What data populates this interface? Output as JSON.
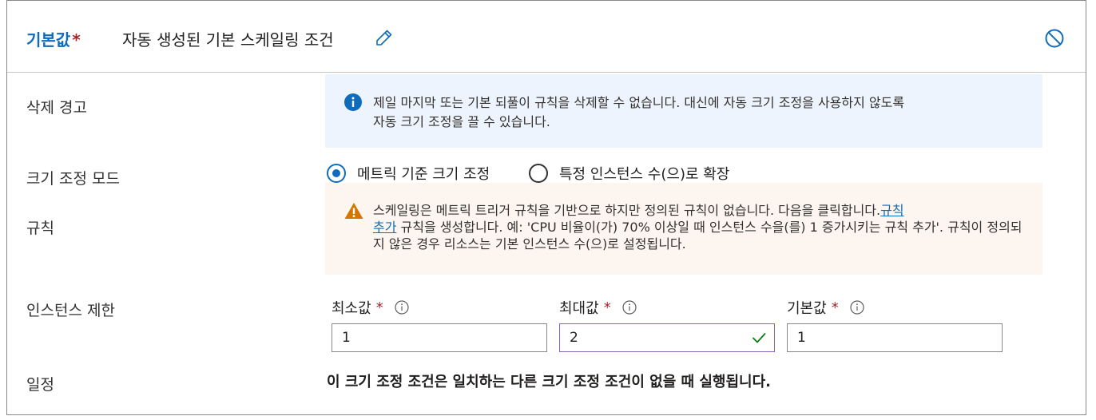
{
  "header": {
    "label": "기본값",
    "required_mark": "*",
    "title": "자동 생성된 기본 스케일링 조건",
    "edit_icon": "pencil-icon",
    "disable_icon": "circle-slash-icon"
  },
  "rows": {
    "delete_warning": "삭제 경고",
    "scale_mode": "크기 조정 모드",
    "rules": "규칙",
    "instance_limits": "인스턴스 제한",
    "schedule": "일정"
  },
  "info_message": {
    "icon": "info-icon",
    "line1": "제일 마지막 또는 기본 되풀이 규칙을 삭제할 수 없습니다. 대신에 자동 크기 조정을 사용하지 않도록",
    "line2": "자동 크기 조정을 끌 수 있습니다."
  },
  "scale_mode": {
    "options": [
      {
        "label": "메트릭 기준 크기 조정",
        "selected": true
      },
      {
        "label": "특정 인스턴스 수(으)로 확장",
        "selected": false
      }
    ]
  },
  "warning_message": {
    "icon": "warning-icon",
    "text_start": "스케일링은 메트릭 트리거 규칙을 기반으로 하지만 정의된 규칙이 없습니다. 다음을 클릭합니다.",
    "link_part1": "규칙",
    "link_part2": "추가",
    "text_end": " 규칙을 생성합니다. 예: 'CPU 비율이(가) 70% 이상일 때 인스턴스 수을(를) 1 증가시키는 규칙 추가'. 규칙이 정의되지 않은 경우 리소스는 기본 인스턴스 수(으)로 설정됩니다."
  },
  "instance_limits": {
    "fields": [
      {
        "label": "최소값",
        "required": "*",
        "value": "1"
      },
      {
        "label": "최대값",
        "required": "*",
        "value": "2"
      },
      {
        "label": "기본값",
        "required": "*",
        "value": "1"
      }
    ]
  },
  "schedule_text": "이 크기 조정 조건은 일치하는 다른 크기 조정 조건이 없을 때 실행됩니다.",
  "colors": {
    "accent": "#0f6cbd",
    "required": "#a4262c",
    "info_bg": "#eef4fd",
    "warning_bg": "#fdf6f0",
    "warning_icon": "#d47500",
    "valid_check": "#107c10"
  }
}
